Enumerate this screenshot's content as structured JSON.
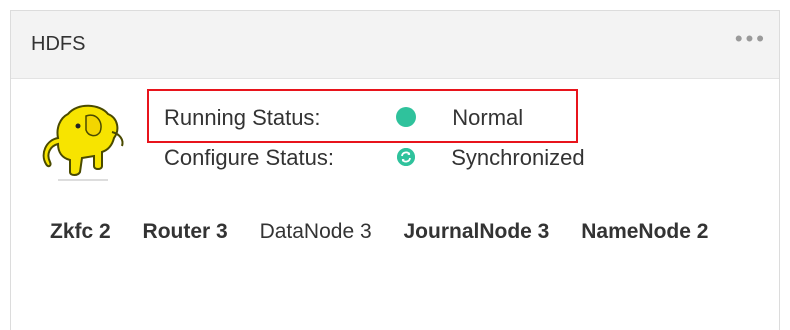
{
  "card": {
    "title": "HDFS",
    "more_label": "•••"
  },
  "status": {
    "running": {
      "label": "Running Status:",
      "value": "Normal",
      "color": "#2fc29c"
    },
    "configure": {
      "label": "Configure Status:",
      "value": "Synchronized",
      "color": "#2fc29c"
    }
  },
  "roles": [
    {
      "text": "Zkfc 2",
      "bold": true
    },
    {
      "text": "Router 3",
      "bold": true
    },
    {
      "text": "DataNode 3",
      "bold": false
    },
    {
      "text": "JournalNode 3",
      "bold": true
    },
    {
      "text": "NameNode 2",
      "bold": true
    }
  ],
  "colors": {
    "highlight": "#e8141c",
    "ok": "#2fc29c",
    "logo_yellow": "#f7e400"
  },
  "icons": {
    "logo": "hadoop-elephant-logo",
    "running": "status-dot-icon",
    "configure": "sync-icon",
    "more": "more-icon"
  }
}
